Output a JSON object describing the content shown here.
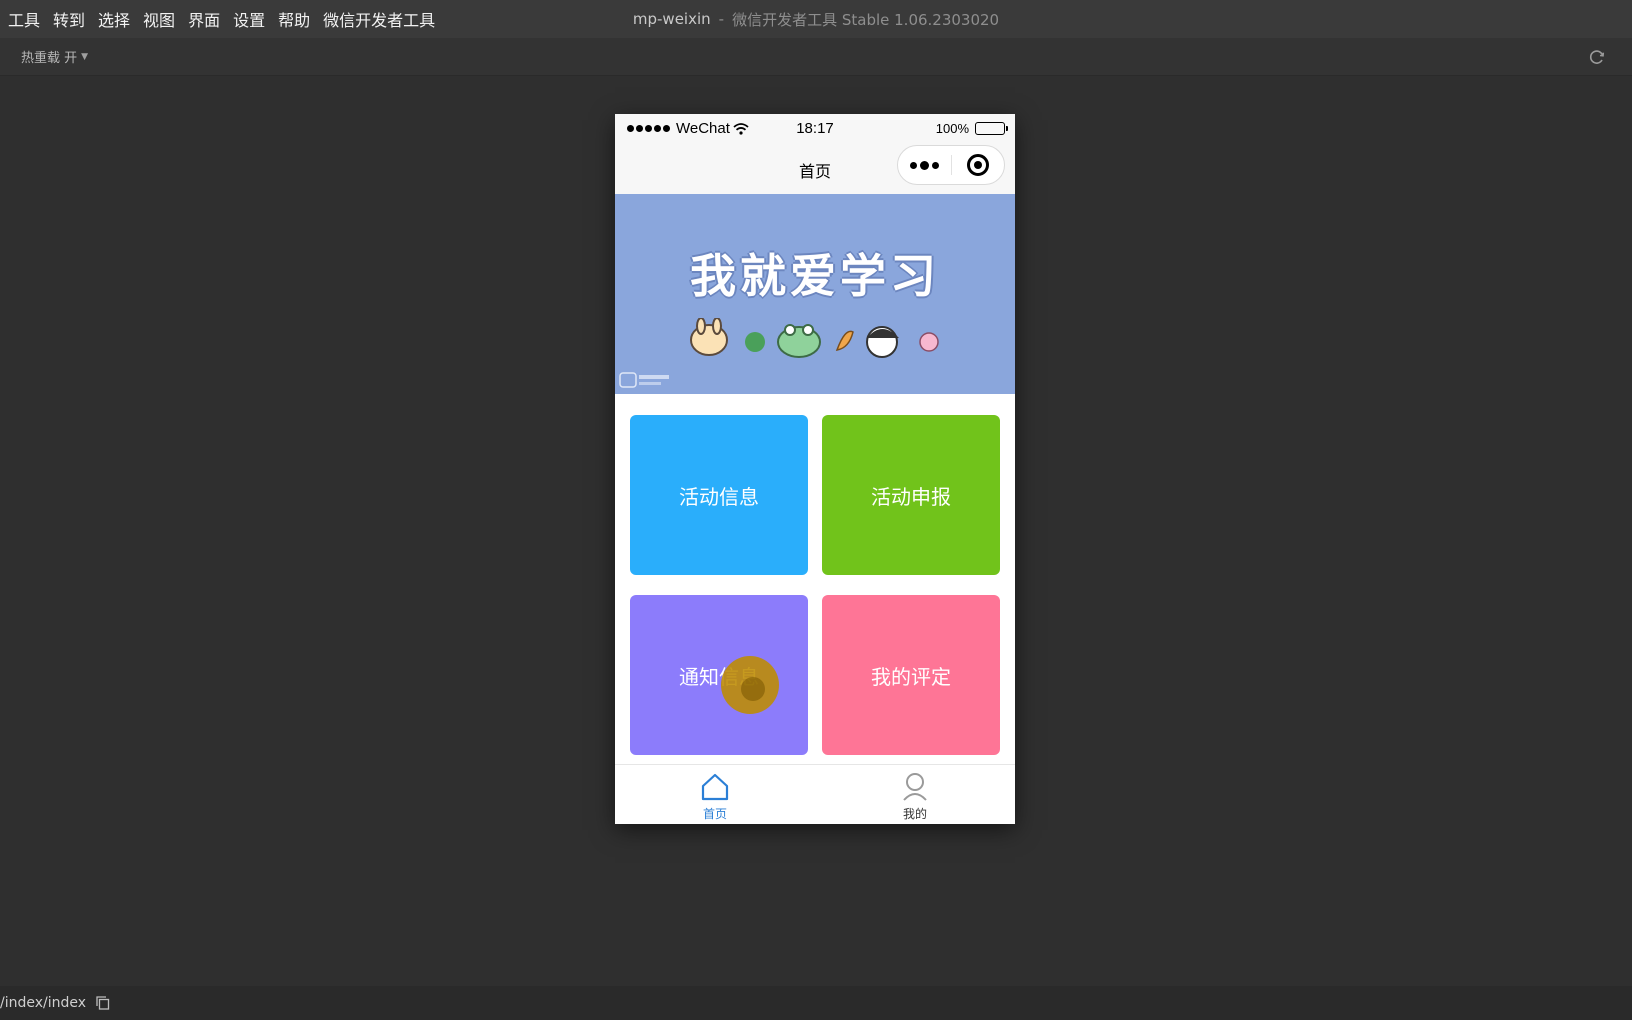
{
  "menu": [
    "工具",
    "转到",
    "选择",
    "视图",
    "界面",
    "设置",
    "帮助",
    "微信开发者工具"
  ],
  "window": {
    "project": "mp-weixin",
    "separator": "-",
    "app_name": "微信开发者工具 Stable 1.06.2303020"
  },
  "toolbar": {
    "hot_reload": "热重载 开"
  },
  "phone": {
    "status": {
      "carrier": "WeChat",
      "time": "18:17",
      "battery": "100%"
    },
    "nav_title": "首页",
    "banner": {
      "text": "我就爱学习"
    },
    "cards": [
      {
        "label": "活动信息",
        "color": "#2aaefb"
      },
      {
        "label": "活动申报",
        "color": "#71c31b"
      },
      {
        "label": "通知信息",
        "color": "#8c7cfb"
      },
      {
        "label": "我的评定",
        "color": "#fe7596"
      }
    ],
    "tabs": [
      {
        "label": "首页",
        "icon": "home-icon",
        "active": true,
        "color": "#2b7fd6"
      },
      {
        "label": "我的",
        "icon": "user-icon",
        "active": false,
        "color": "#333333"
      }
    ]
  },
  "footer": {
    "path": "/index/index"
  }
}
